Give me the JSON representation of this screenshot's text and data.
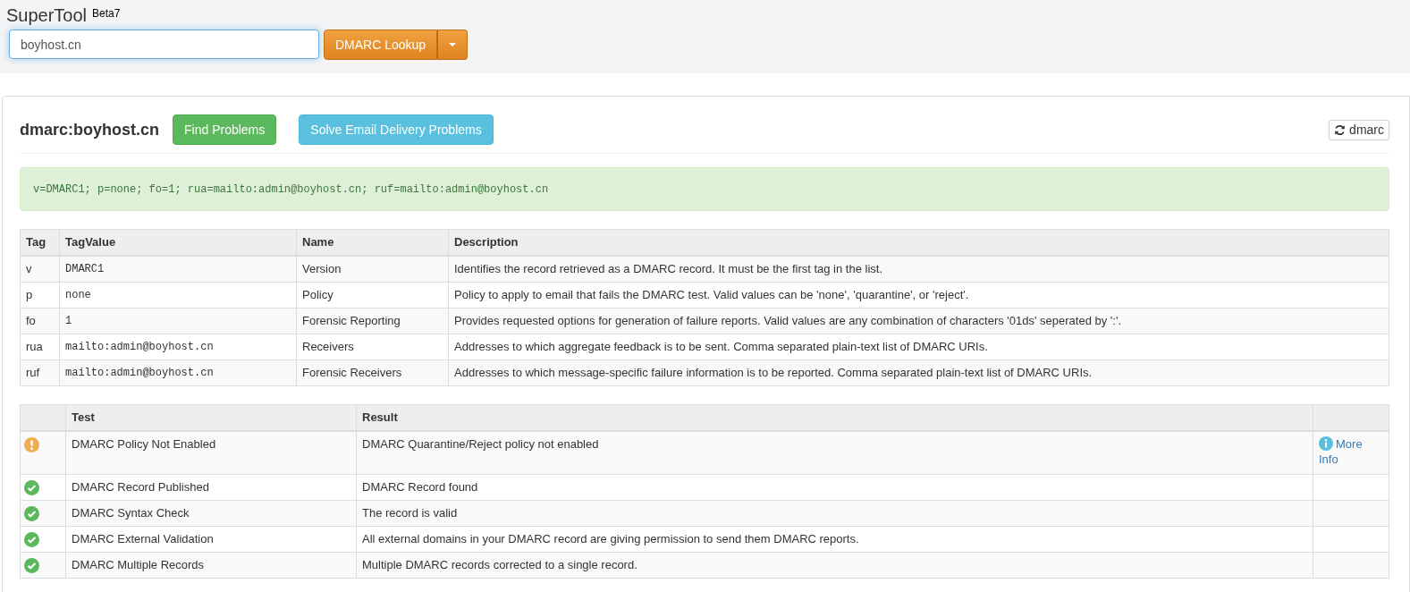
{
  "header": {
    "title": "SuperTool",
    "badge": "Beta7",
    "search": {
      "value": "boyhost.cn"
    },
    "lookup_button": "DMARC Lookup"
  },
  "panel": {
    "title": "dmarc:boyhost.cn",
    "buttons": [
      {
        "label": "Find Problems",
        "kind": "success"
      },
      {
        "label": "Solve Email Delivery Problems",
        "kind": "info"
      }
    ],
    "refresh_button": "dmarc",
    "record": "v=DMARC1; p=none; fo=1; rua=mailto:admin@boyhost.cn; ruf=mailto:admin@boyhost.cn"
  },
  "tag_table": {
    "columns": [
      "Tag",
      "TagValue",
      "Name",
      "Description"
    ],
    "rows": [
      {
        "tag": "v",
        "value": "DMARC1",
        "name": "Version",
        "description": "Identifies the record retrieved as a DMARC record. It must be the first tag in the list."
      },
      {
        "tag": "p",
        "value": "none",
        "name": "Policy",
        "description": "Policy to apply to email that fails the DMARC test. Valid values can be 'none', 'quarantine', or 'reject'."
      },
      {
        "tag": "fo",
        "value": "1",
        "name": "Forensic Reporting",
        "description": "Provides requested options for generation of failure reports. Valid values are any combination of characters '01ds' seperated by ':'."
      },
      {
        "tag": "rua",
        "value": "mailto:admin@boyhost.cn",
        "name": "Receivers",
        "description": "Addresses to which aggregate feedback is to be sent. Comma separated plain-text list of DMARC URIs."
      },
      {
        "tag": "ruf",
        "value": "mailto:admin@boyhost.cn",
        "name": "Forensic Receivers",
        "description": "Addresses to which message-specific failure information is to be reported. Comma separated plain-text list of DMARC URIs."
      }
    ]
  },
  "test_table": {
    "columns": [
      "Test",
      "Result"
    ],
    "rows": [
      {
        "kind": "warning",
        "test": "DMARC Policy Not Enabled",
        "result": "DMARC Quarantine/Reject policy not enabled",
        "more_info": "More Info"
      },
      {
        "kind": "pass",
        "test": "DMARC Record Published",
        "result": "DMARC Record found"
      },
      {
        "kind": "pass",
        "test": "DMARC Syntax Check",
        "result": "The record is valid"
      },
      {
        "kind": "pass",
        "test": "DMARC External Validation",
        "result": "All external domains in your DMARC record are giving permission to send them DMARC reports."
      },
      {
        "kind": "pass",
        "test": "DMARC Multiple Records",
        "result": "Multiple DMARC records corrected to a single record."
      }
    ]
  }
}
